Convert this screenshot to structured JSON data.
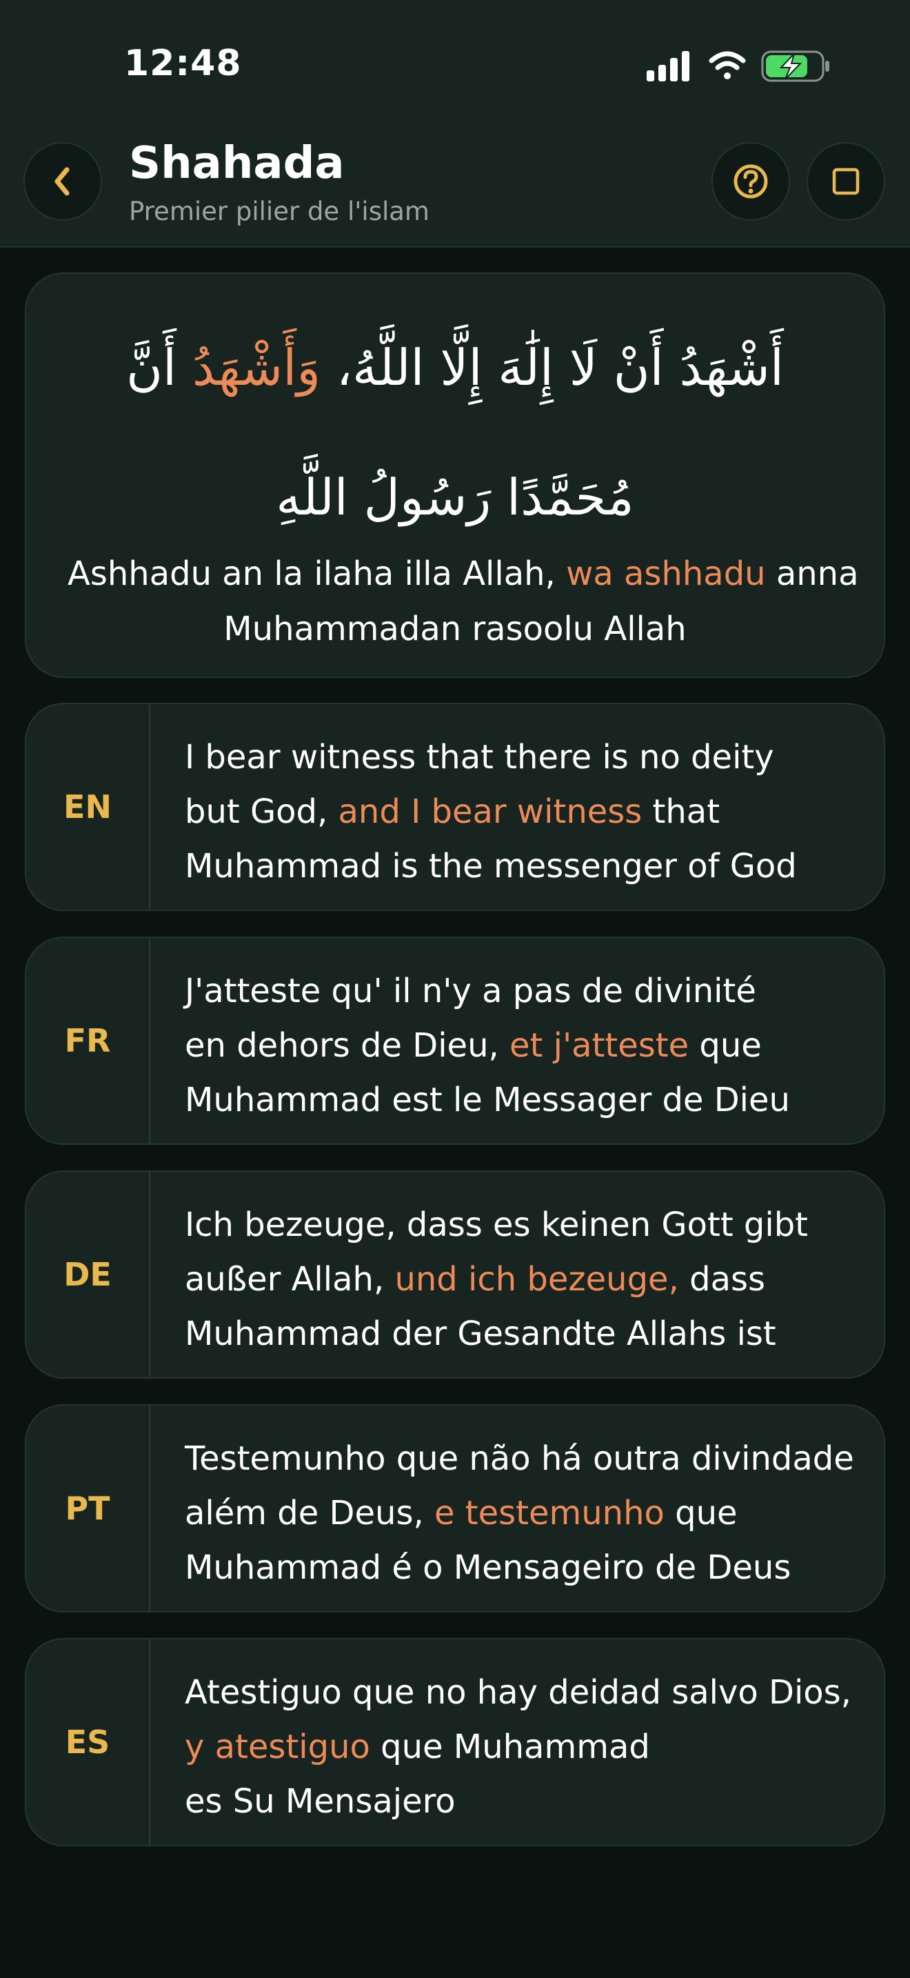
{
  "status_bar": {
    "time": "12:48"
  },
  "header": {
    "title": "Shahada",
    "subtitle": "Premier pilier de l'islam"
  },
  "icons": {
    "back": "chevron-left-icon",
    "help": "question-circle-icon",
    "expand": "square-icon"
  },
  "colors": {
    "accent_gold": "#e9b84e",
    "highlight_orange": "#ee8a58",
    "card_bg": "#17241f"
  },
  "arabic": {
    "part1": "أَشْهَدُ أَنْ لَا إِلَٰهَ إِلَّا اللَّهُ، ",
    "highlight": "وَأَشْهَدُ",
    "part2": " أَنَّ مُحَمَّدًا رَسُولُ اللَّهِ"
  },
  "transliteration": {
    "part1": "Ashhadu an la ilaha illa Allah, ",
    "highlight": "wa ashhadu",
    "part2": " anna",
    "line2": "Muhammadan rasoolu Allah"
  },
  "translations": [
    {
      "code": "EN",
      "l1": "I bear witness that there is no deity",
      "l2a": "but God, ",
      "l2h": "and I bear witness",
      "l2b": " that",
      "l3": "Muhammad is the messenger of God"
    },
    {
      "code": "FR",
      "l1": "J'atteste qu' il n'y a pas de divinité",
      "l2a": "en dehors de Dieu, ",
      "l2h": "et j'atteste",
      "l2b": " que",
      "l3": "Muhammad est le Messager de Dieu"
    },
    {
      "code": "DE",
      "l1": "Ich bezeuge, dass es keinen Gott gibt",
      "l2a": "außer Allah, ",
      "l2h": "und ich bezeuge,",
      "l2b": " dass",
      "l3": "Muhammad der Gesandte Allahs ist"
    },
    {
      "code": "PT",
      "l1": "Testemunho que não há outra divindade",
      "l2a": "além de Deus, ",
      "l2h": "e testemunho",
      "l2b": " que",
      "l3": "Muhammad é o Mensageiro de Deus"
    },
    {
      "code": "ES",
      "l1": "Atestiguo que no hay deidad salvo Dios,",
      "l2a": "",
      "l2h": "y atestiguo",
      "l2b": " que Muhammad",
      "l3": "es Su Mensajero"
    }
  ]
}
